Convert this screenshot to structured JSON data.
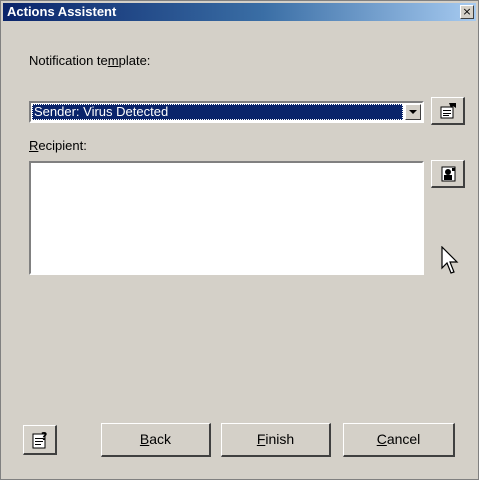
{
  "window": {
    "title": "Actions Assistent",
    "close_glyph": "×"
  },
  "template": {
    "label_pre": "Notification te",
    "label_u": "m",
    "label_post": "plate:",
    "selected_value": "Sender: Virus Detected",
    "properties_icon": "properties-icon"
  },
  "recipient": {
    "label_u": "R",
    "label_post": "ecipient:",
    "value": "",
    "address_book_icon": "address-book-icon"
  },
  "footer": {
    "help_icon": "help-icon",
    "back_u": "B",
    "back_post": "ack",
    "finish_u": "F",
    "finish_post": "inish",
    "cancel_u": "C",
    "cancel_post": "ancel"
  },
  "colors": {
    "dialog_bg": "#d4d0c8",
    "title_bg": "#0a246a",
    "selection_bg": "#0a246a"
  }
}
